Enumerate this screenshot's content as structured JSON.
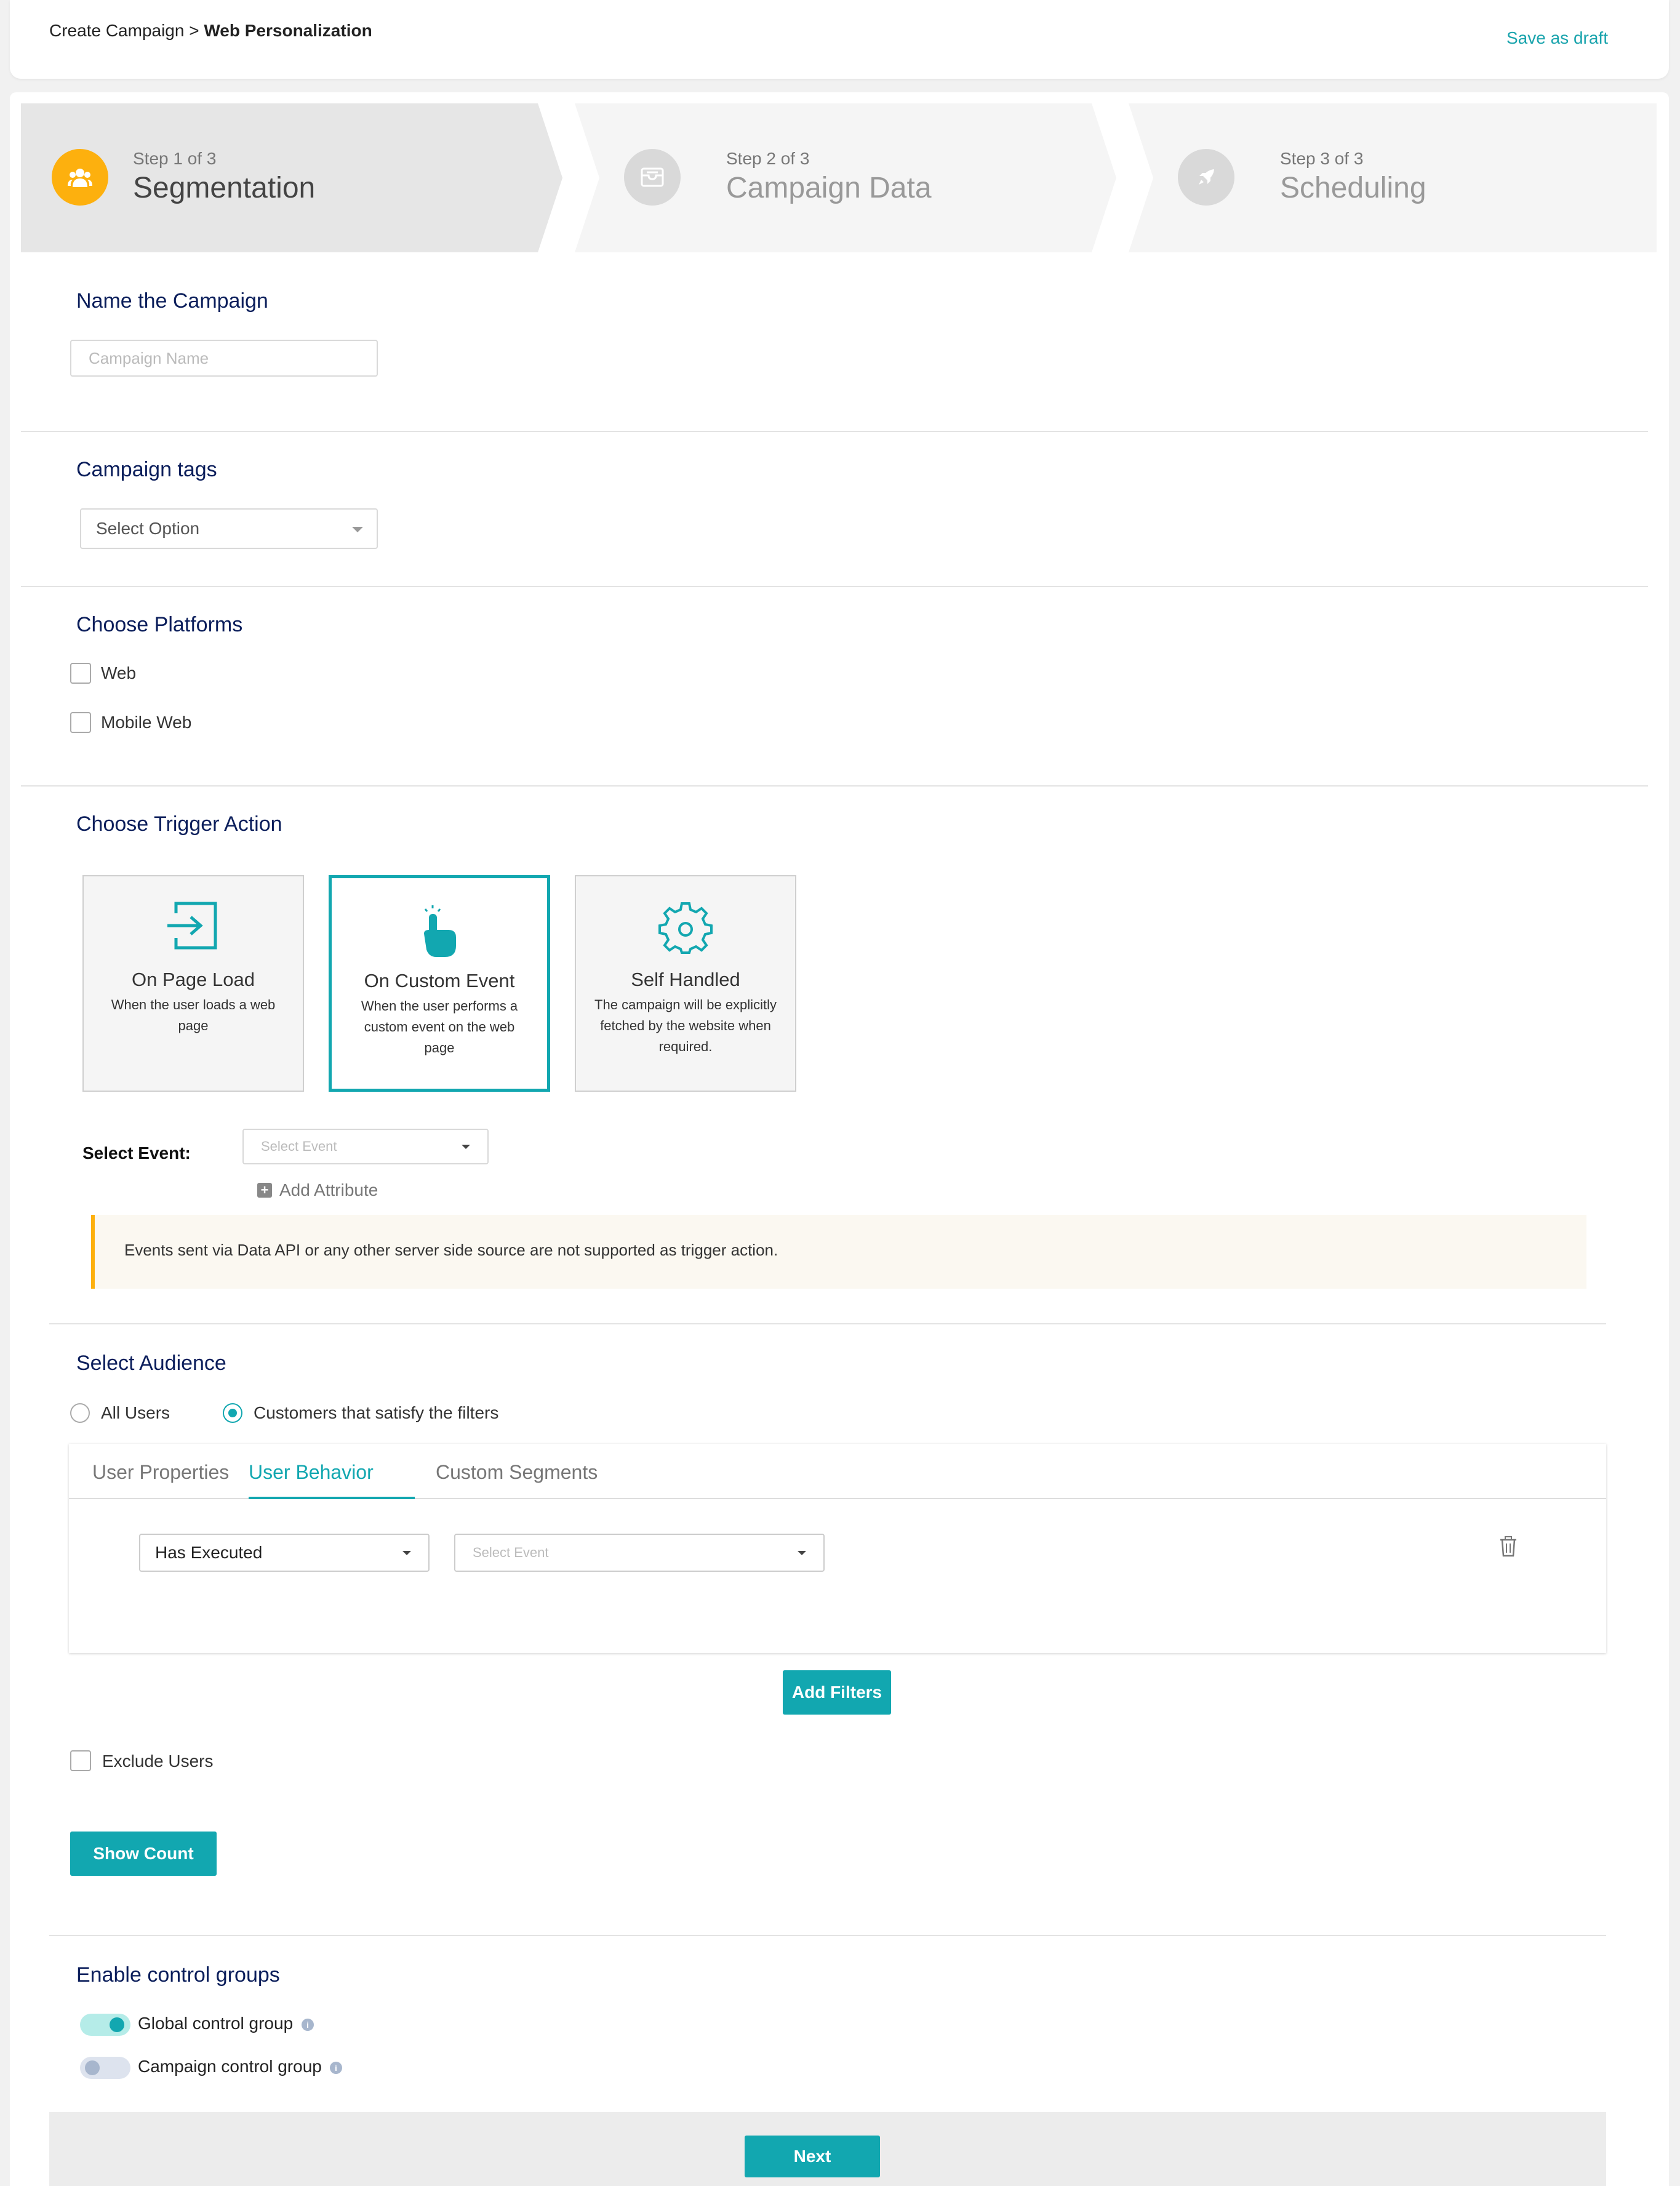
{
  "header": {
    "breadcrumb_parent": "Create Campaign",
    "breadcrumb_sep": ">",
    "breadcrumb_current": "Web Personalization",
    "save_draft": "Save as draft"
  },
  "steps": [
    {
      "sub": "Step 1 of 3",
      "title": "Segmentation",
      "icon": "users-icon",
      "active": true
    },
    {
      "sub": "Step 2 of 3",
      "title": "Campaign Data",
      "icon": "inbox-icon",
      "active": false
    },
    {
      "sub": "Step 3 of 3",
      "title": "Scheduling",
      "icon": "rocket-icon",
      "active": false
    }
  ],
  "name_section": {
    "heading": "Name the Campaign",
    "placeholder": "Campaign Name"
  },
  "tags_section": {
    "heading": "Campaign tags",
    "select_placeholder": "Select Option"
  },
  "platforms": {
    "heading": "Choose Platforms",
    "options": [
      "Web",
      "Mobile Web"
    ]
  },
  "trigger": {
    "heading": "Choose Trigger Action",
    "cards": [
      {
        "title": "On Page Load",
        "desc": "When the user loads a web page",
        "icon": "enter-icon",
        "selected": false
      },
      {
        "title": "On Custom Event",
        "desc": "When the user performs a custom event on the web page",
        "icon": "tap-icon",
        "selected": true
      },
      {
        "title": "Self Handled",
        "desc": "The campaign will be explicitly fetched by the website when required.",
        "icon": "gear-icon",
        "selected": false
      }
    ],
    "select_event_label": "Select Event:",
    "select_event_placeholder": "Select Event",
    "add_attribute": "Add Attribute",
    "notice": "Events sent via Data API or any other server side source are not supported as trigger action."
  },
  "audience": {
    "heading": "Select Audience",
    "radio_all": "All Users",
    "radio_filters": "Customers that satisfy the filters",
    "tabs": [
      "User Properties",
      "User Behavior",
      "Custom Segments"
    ],
    "active_tab": "User Behavior",
    "filter_condition": "Has Executed",
    "filter_event_placeholder": "Select Event",
    "add_filters": "Add Filters",
    "exclude_users": "Exclude Users",
    "show_count": "Show Count"
  },
  "control_groups": {
    "heading": "Enable control groups",
    "global": "Global control group",
    "campaign": "Campaign control group",
    "global_on": true,
    "campaign_on": false
  },
  "footer": {
    "next": "Next"
  },
  "colors": {
    "accent": "#12a7b0",
    "heading": "#0b1e5b",
    "step_active": "#fdb00e"
  }
}
